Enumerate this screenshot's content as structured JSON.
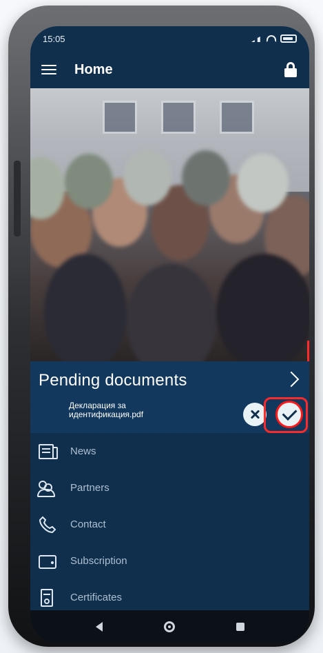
{
  "status": {
    "time": "15:05"
  },
  "appbar": {
    "title": "Home"
  },
  "pending": {
    "title": "Pending documents",
    "document_name": "Декларация за\nидентификация.pdf"
  },
  "menu": {
    "items": [
      {
        "label": "News",
        "icon": "news-icon"
      },
      {
        "label": "Partners",
        "icon": "partners-icon"
      },
      {
        "label": "Contact",
        "icon": "phone-icon"
      },
      {
        "label": "Subscription",
        "icon": "wallet-icon"
      },
      {
        "label": "Certificates",
        "icon": "certificate-icon"
      }
    ]
  },
  "colors": {
    "background": "#0f2f4d",
    "pending_bg": "#12385d",
    "highlight": "#ff1a1a"
  }
}
